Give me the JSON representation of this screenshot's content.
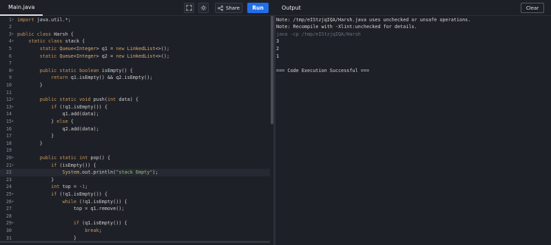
{
  "tab": {
    "filename": "Main.java"
  },
  "toolbar": {
    "share_label": "Share",
    "run_label": "Run"
  },
  "output_panel": {
    "title": "Output",
    "clear_label": "Clear",
    "lines": [
      "Note: /tmp/eIStzjqIQA/Harsh.java uses unchecked or unsafe operations.",
      "Note: Recompile with -Xlint:unchecked for details.",
      "java -cp /tmp/eIStzjqIQA/Harsh",
      "3",
      "2",
      "1",
      "",
      "=== Code Execution Successful ==="
    ]
  },
  "editor": {
    "active_line": 22,
    "lines": [
      {
        "n": "1",
        "fold": true,
        "text": "import java.util.*;"
      },
      {
        "n": "2",
        "fold": false,
        "text": ""
      },
      {
        "n": "3",
        "fold": true,
        "text": "public class Harsh {"
      },
      {
        "n": "4",
        "fold": true,
        "text": "    static class stack {"
      },
      {
        "n": "5",
        "fold": false,
        "text": "        static Queue<Integer> q1 = new LinkedList<>();"
      },
      {
        "n": "6",
        "fold": false,
        "text": "        static Queue<Integer> q2 = new LinkedList<>();"
      },
      {
        "n": "7",
        "fold": false,
        "text": ""
      },
      {
        "n": "8",
        "fold": true,
        "text": "        public static boolean isEmpty() {"
      },
      {
        "n": "9",
        "fold": false,
        "text": "            return q1.isEmpty() && q2.isEmpty();"
      },
      {
        "n": "10",
        "fold": false,
        "text": "        }"
      },
      {
        "n": "11",
        "fold": false,
        "text": ""
      },
      {
        "n": "12",
        "fold": true,
        "text": "        public static void push(int data) {"
      },
      {
        "n": "13",
        "fold": true,
        "text": "            if (!q1.isEmpty()) {"
      },
      {
        "n": "14",
        "fold": false,
        "text": "                q1.add(data);"
      },
      {
        "n": "15",
        "fold": true,
        "text": "            } else {"
      },
      {
        "n": "16",
        "fold": false,
        "text": "                q2.add(data);"
      },
      {
        "n": "17",
        "fold": false,
        "text": "            }"
      },
      {
        "n": "18",
        "fold": false,
        "text": "        }"
      },
      {
        "n": "19",
        "fold": false,
        "text": ""
      },
      {
        "n": "20",
        "fold": true,
        "text": "        public static int pop() {"
      },
      {
        "n": "21",
        "fold": true,
        "text": "            if (isEmpty()) {"
      },
      {
        "n": "22",
        "fold": false,
        "text": "                System.out.println(\"stack Empty\");"
      },
      {
        "n": "23",
        "fold": false,
        "text": "            }"
      },
      {
        "n": "24",
        "fold": false,
        "text": "            int top = -1;"
      },
      {
        "n": "25",
        "fold": true,
        "text": "            if (!q1.isEmpty()) {"
      },
      {
        "n": "26",
        "fold": true,
        "text": "                while (!q1.isEmpty()) {"
      },
      {
        "n": "27",
        "fold": false,
        "text": "                    top = q1.remove();"
      },
      {
        "n": "28",
        "fold": false,
        "text": ""
      },
      {
        "n": "29",
        "fold": true,
        "text": "                    if (q1.isEmpty()) {"
      },
      {
        "n": "30",
        "fold": false,
        "text": "                        break;"
      },
      {
        "n": "31",
        "fold": false,
        "text": "                    }"
      }
    ]
  }
}
